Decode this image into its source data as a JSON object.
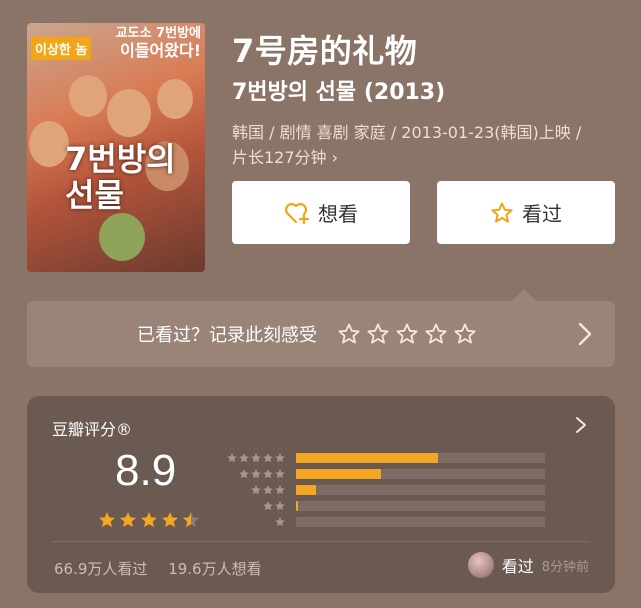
{
  "poster": {
    "tag_left": "이상한 놈",
    "tag_right_line1": "교도소 7번방에",
    "tag_right_line2": "이들어왔다!",
    "title_line1": "7번방의",
    "title_line2": "선물"
  },
  "movie": {
    "title": "7号房的礼物",
    "original_title": "7번방의 선물 (2013)",
    "meta_line1": "韩国 / 剧情 喜剧 家庭 / 2013-01-23(韩国)上映 /",
    "meta_line2": "片长127分钟 ›"
  },
  "buttons": {
    "want_label": "想看",
    "seen_label": "看过"
  },
  "record": {
    "prompt": "已看过？记录此刻感受",
    "star_count": 5
  },
  "rating": {
    "label": "豆瓣评分®",
    "score": "8.9",
    "star_value": 4.5,
    "distribution": [
      {
        "stars": 5,
        "fraction": 0.57
      },
      {
        "stars": 4,
        "fraction": 0.34
      },
      {
        "stars": 3,
        "fraction": 0.08
      },
      {
        "stars": 2,
        "fraction": 0.01
      },
      {
        "stars": 1,
        "fraction": 0.0
      }
    ],
    "seen_count": "66.9万人看过",
    "want_count": "19.6万人想看"
  },
  "activity": {
    "action": "看过",
    "time": "8分钟前"
  },
  "colors": {
    "background": "#8a7367",
    "card": "#6b5a52",
    "accent": "#f5a623",
    "button_icon": "#f0a416"
  },
  "icons": {
    "want": "heart-plus-icon",
    "seen": "star-outline-icon",
    "chevron": "chevron-right-icon"
  }
}
